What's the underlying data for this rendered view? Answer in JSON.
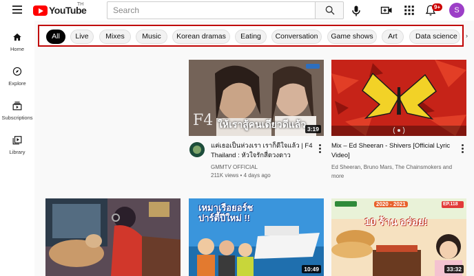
{
  "header": {
    "logo_text": "YouTube",
    "logo_region": "TH",
    "search_placeholder": "Search",
    "notification_count": "9+",
    "avatar_letter": "S"
  },
  "sidebar": {
    "items": [
      {
        "label": "Home",
        "icon": "home-icon"
      },
      {
        "label": "Explore",
        "icon": "compass-icon"
      },
      {
        "label": "Subscriptions",
        "icon": "subscriptions-icon"
      },
      {
        "label": "Library",
        "icon": "library-icon"
      }
    ]
  },
  "chips": [
    "All",
    "Live",
    "Mixes",
    "Music",
    "Korean dramas",
    "Eating",
    "Conversation",
    "Game shows",
    "Art",
    "Data science"
  ],
  "videos": [
    {
      "title": "แค่เธอเป็นห่วงเรา เราก็ดีใจแล้ว | F4 Thailand : หัวใจรักสี่ดวงดาว BOYS...",
      "channel": "GMMTV OFFICIAL",
      "meta": "211K views • 4 days ago",
      "duration": "3:19",
      "overlay_text": "ให้เราสู้คนเดียวดีแล้ว"
    },
    {
      "title": "Mix – Ed Sheeran - Shivers [Official Lyric Video]",
      "channel": "Ed Sheeran, Bruno Mars, The Chainsmokers and more",
      "duration": ""
    },
    {
      "title": "",
      "duration": ""
    },
    {
      "title": "",
      "duration": "10:49",
      "overlay_text": "เหมาเรือยอร์ช ปาร์ตี้ปีใหม่ !!"
    },
    {
      "title": "",
      "duration": "33:32",
      "overlay_text": "10 ร้าน อร่อย!",
      "year_text": "2020 - 2021",
      "ep_text": "EP.118"
    }
  ],
  "colors": {
    "accent_red": "#ff0000",
    "chip_highlight_border": "#c00000",
    "avatar_bg": "#9c3fc7"
  }
}
